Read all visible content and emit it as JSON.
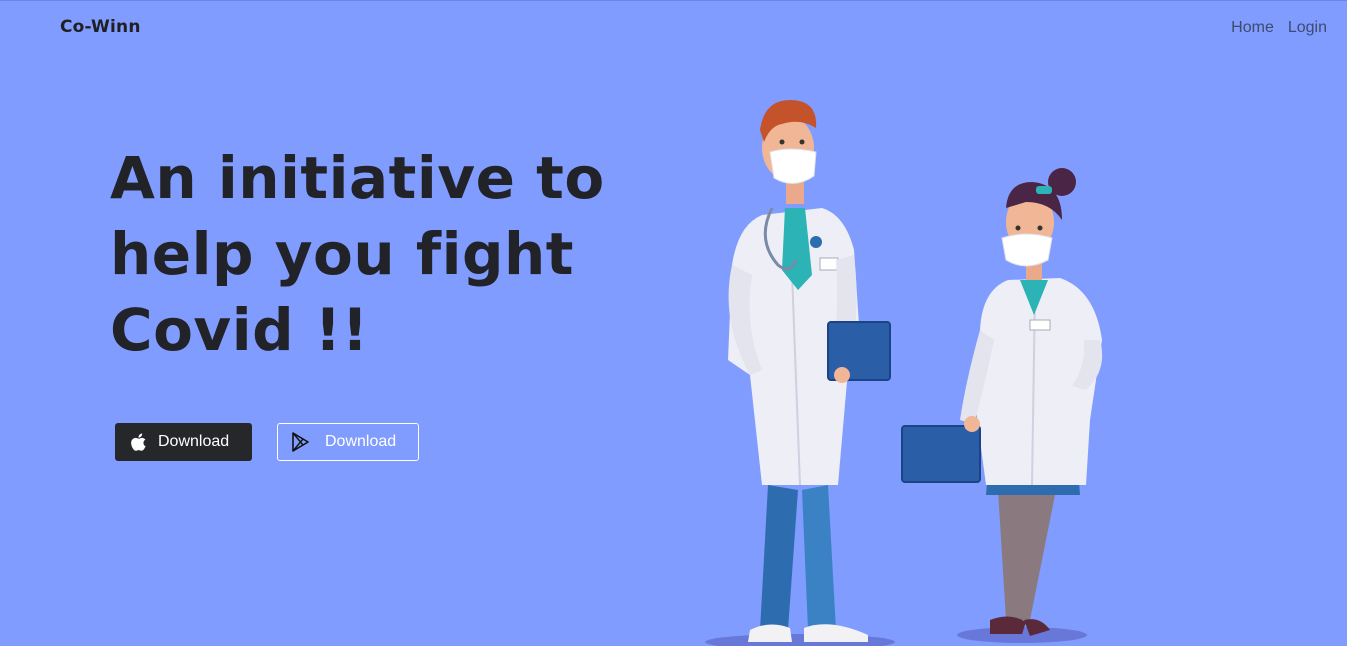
{
  "header": {
    "brand": "Co-Winn",
    "nav": [
      {
        "label": "Home"
      },
      {
        "label": "Login"
      }
    ]
  },
  "hero": {
    "headline_lines": [
      "An initiative to",
      "help you fight",
      "Covid !!"
    ],
    "buttons": [
      {
        "label": "Download",
        "icon": "apple-icon"
      },
      {
        "label": "Download",
        "icon": "google-play-icon"
      }
    ]
  },
  "colors": {
    "background": "#809cff",
    "text": "#222329",
    "apple_button": "#25272b"
  }
}
